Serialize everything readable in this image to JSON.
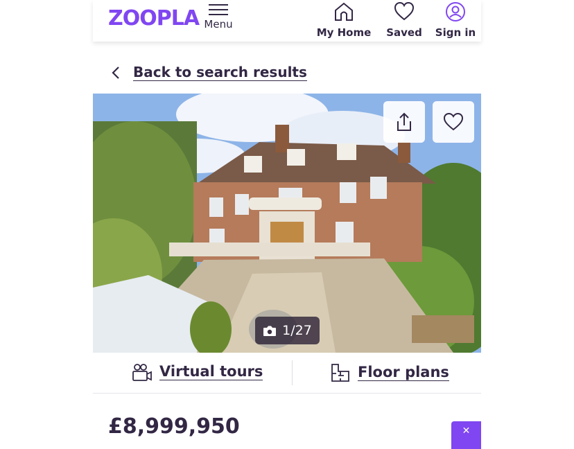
{
  "header": {
    "logo_text": "ZOOPLA",
    "menu_label": "Menu",
    "nav": [
      {
        "label": "My Home",
        "icon": "home-icon"
      },
      {
        "label": "Saved",
        "icon": "heart-icon"
      },
      {
        "label": "Sign in",
        "icon": "user-icon"
      }
    ]
  },
  "back_link": {
    "label": "Back to search results",
    "icon": "chevron-left-icon"
  },
  "gallery": {
    "counter": "1/27",
    "share_icon": "share-icon",
    "save_icon": "heart-icon",
    "counter_icon": "camera-icon"
  },
  "media_links": {
    "virtual_tours": "Virtual tours",
    "floor_plans": "Floor plans"
  },
  "listing": {
    "price": "£8,999,950"
  },
  "side_tab": {
    "glyph": "✕"
  },
  "colors": {
    "brand": "#8046f1",
    "text": "#322744"
  }
}
